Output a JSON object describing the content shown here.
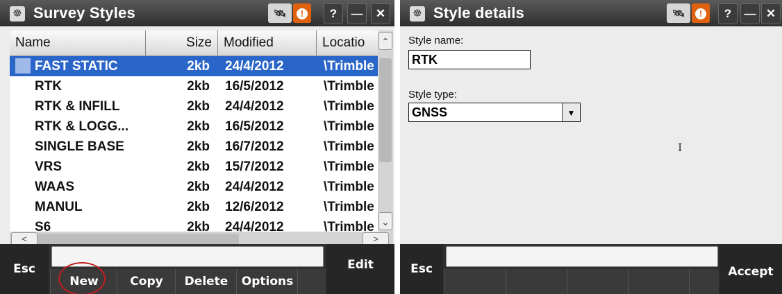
{
  "left_window": {
    "title": "Survey Styles",
    "icons": {
      "app": "trimble-logo-icon",
      "sat": "satellite-icon",
      "warn": "warning-icon",
      "help": "?",
      "min": "—",
      "close": "✕"
    },
    "columns": [
      "Name",
      "Size",
      "Modified",
      "Locatio"
    ],
    "rows": [
      {
        "name": "FAST STATIC",
        "size": "2kb",
        "modified": "24/4/2012",
        "location": "\\Trimble",
        "selected": true
      },
      {
        "name": "RTK",
        "size": "2kb",
        "modified": "16/5/2012",
        "location": "\\Trimble"
      },
      {
        "name": "RTK & INFILL",
        "size": "2kb",
        "modified": "24/4/2012",
        "location": "\\Trimble"
      },
      {
        "name": "RTK & LOGG...",
        "size": "2kb",
        "modified": "16/5/2012",
        "location": "\\Trimble"
      },
      {
        "name": "SINGLE BASE",
        "size": "2kb",
        "modified": "16/7/2012",
        "location": "\\Trimble"
      },
      {
        "name": "VRS",
        "size": "2kb",
        "modified": "15/7/2012",
        "location": "\\Trimble"
      },
      {
        "name": "WAAS",
        "size": "2kb",
        "modified": "24/4/2012",
        "location": "\\Trimble"
      },
      {
        "name": "MANUL",
        "size": "2kb",
        "modified": "12/6/2012",
        "location": "\\Trimble"
      },
      {
        "name": "S6",
        "size": "2kb",
        "modified": "24/4/2012",
        "location": "\\Trimble"
      }
    ],
    "softkeys": {
      "esc": "Esc",
      "new": "New",
      "copy": "Copy",
      "delete": "Delete",
      "options": "Options",
      "edit": "Edit"
    }
  },
  "right_window": {
    "title": "Style details",
    "icons": {
      "app": "trimble-logo-icon",
      "sat": "satellite-icon",
      "warn": "warning-icon",
      "help": "?",
      "min": "—",
      "close": "✕"
    },
    "style_name_label": "Style name:",
    "style_name_value": "RTK",
    "style_type_label": "Style type:",
    "style_type_value": "GNSS",
    "softkeys": {
      "esc": "Esc",
      "accept": "Accept"
    }
  },
  "colors": {
    "selection": "#2a65c9",
    "title_bar": "#3a3a3a",
    "warning": "#e0620f",
    "highlight_circle": "#c21d1d"
  }
}
